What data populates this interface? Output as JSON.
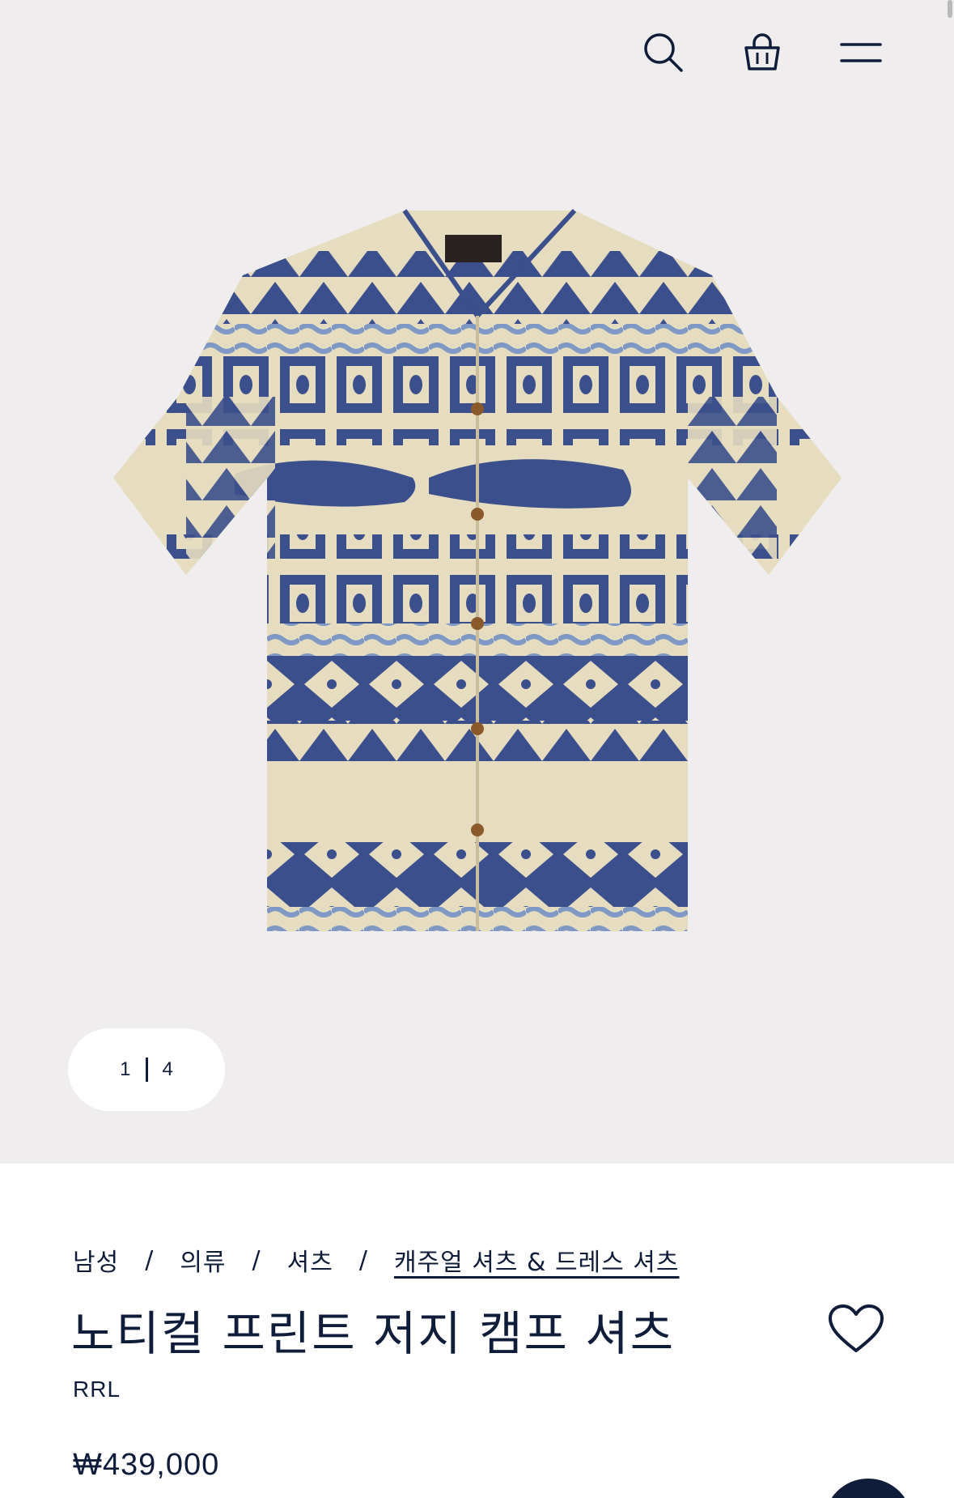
{
  "header": {
    "icons": [
      "search-icon",
      "shopping-bag-icon",
      "menu-icon"
    ]
  },
  "gallery": {
    "current": "1",
    "total": "4"
  },
  "breadcrumb": {
    "items": [
      "남성",
      "의류",
      "셔츠",
      "캐주얼 셔츠 & 드레스 셔츠"
    ],
    "separator": "/"
  },
  "product": {
    "title": "노티컬 프린트 저지 캠프 셔츠",
    "brand": "RRL",
    "price": "₩439,000"
  },
  "colors": {
    "hero_bg": "#efeded",
    "navy": "#0f1d3a",
    "shirt_base": "#e6dcc0",
    "shirt_print": "#3b4f8c",
    "shirt_print_light": "#7f98c6"
  }
}
